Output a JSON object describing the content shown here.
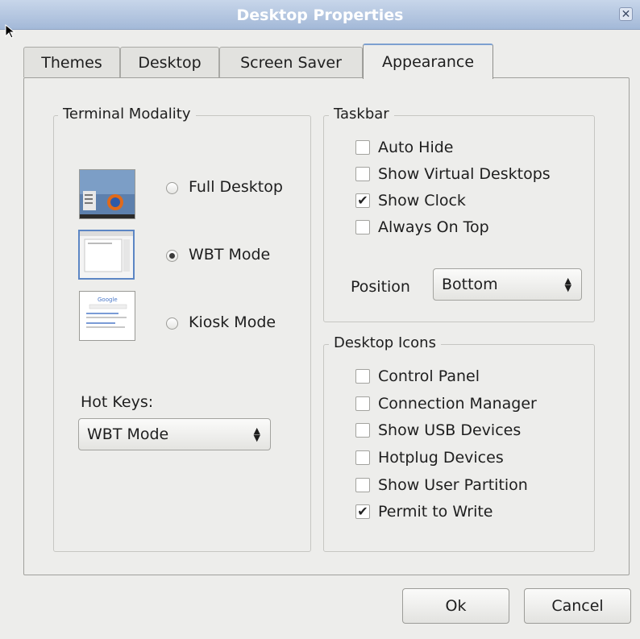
{
  "window": {
    "title": "Desktop Properties",
    "close_icon": "close-icon"
  },
  "tabs": [
    {
      "label": "Themes",
      "active": false
    },
    {
      "label": "Desktop",
      "active": false
    },
    {
      "label": "Screen Saver",
      "active": false
    },
    {
      "label": "Appearance",
      "active": true
    }
  ],
  "terminal_modality": {
    "title": "Terminal Modality",
    "options": [
      {
        "label": "Full Desktop",
        "selected": false,
        "icon": "full-desktop-thumbnail"
      },
      {
        "label": "WBT Mode",
        "selected": true,
        "icon": "wbt-mode-thumbnail"
      },
      {
        "label": "Kiosk Mode",
        "selected": false,
        "icon": "kiosk-mode-thumbnail"
      }
    ],
    "hot_keys_label": "Hot Keys:",
    "hot_keys_value": "WBT Mode"
  },
  "taskbar": {
    "title": "Taskbar",
    "options": [
      {
        "label": "Auto Hide",
        "checked": false
      },
      {
        "label": "Show Virtual Desktops",
        "checked": false
      },
      {
        "label": "Show Clock",
        "checked": true
      },
      {
        "label": "Always On Top",
        "checked": false
      }
    ],
    "position_label": "Position",
    "position_value": "Bottom"
  },
  "desktop_icons": {
    "title": "Desktop Icons",
    "options": [
      {
        "label": "Control Panel",
        "checked": false
      },
      {
        "label": "Connection Manager",
        "checked": false
      },
      {
        "label": "Show USB Devices",
        "checked": false
      },
      {
        "label": "Hotplug Devices",
        "checked": false
      },
      {
        "label": "Show User Partition",
        "checked": false
      },
      {
        "label": "Permit to Write",
        "checked": true
      }
    ]
  },
  "buttons": {
    "ok": "Ok",
    "cancel": "Cancel"
  },
  "colors": {
    "titlebar": "#a3b9d8",
    "accent": "#5c86c4"
  }
}
